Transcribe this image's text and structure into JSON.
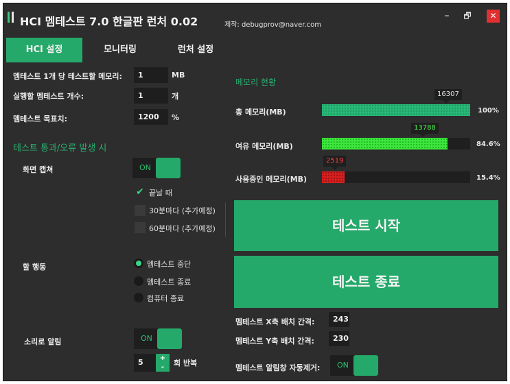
{
  "window": {
    "title": "HCI 멤테스트 7.0 한글판 런처 0.02",
    "maker": "제작: debugprov@naver.com",
    "minimize_glyph": "–",
    "restore_glyph": "🗗",
    "close_glyph": "✕"
  },
  "tabs": [
    {
      "label": "HCI 설정",
      "active": true
    },
    {
      "label": "모니터링",
      "active": false
    },
    {
      "label": "런처 설정",
      "active": false
    }
  ],
  "settings": {
    "memory_per_test": {
      "label": "멤테스트 1개 당 테스트할 메모리:",
      "value": "1",
      "unit": "MB"
    },
    "instance_count": {
      "label": "실행할 멤테스트 개수:",
      "value": "1",
      "unit": "개"
    },
    "target": {
      "label": "멤테스트 목표치:",
      "value": "1200",
      "unit": "%"
    }
  },
  "on_event": {
    "section_title": "테스트 통과/오류 발생 시",
    "capture": {
      "label": "화면 캡쳐",
      "toggle": "ON"
    },
    "capture_options": [
      {
        "label": "끝날 때",
        "checked": true,
        "glyph": "✔"
      },
      {
        "label": "30분마다 (추가예정)",
        "checked": false
      },
      {
        "label": "60분마다 (추가예정)",
        "checked": false
      }
    ],
    "action": {
      "label": "할 행동",
      "options": [
        {
          "label": "멤테스트 중단",
          "selected": true
        },
        {
          "label": "멤테스트 종료",
          "selected": false
        },
        {
          "label": "컴퓨터 종료",
          "selected": false
        }
      ]
    },
    "sound": {
      "label": "소리로 알림",
      "toggle": "ON",
      "repeat": "5",
      "plus": "+",
      "minus": "-",
      "repeat_unit": "회 반복"
    }
  },
  "memory": {
    "section_title": "메모리 현황",
    "total": {
      "label": "총 메모리(MB)",
      "value": "16307",
      "percent_text": "100%",
      "fraction": 1.0,
      "color": "#28b878"
    },
    "free": {
      "label": "여유 메모리(MB)",
      "value": "13788",
      "percent_text": "84.6%",
      "fraction": 0.846,
      "color": "#3ee63e"
    },
    "used": {
      "label": "사용중인 메모리(MB)",
      "value": "2519",
      "percent_text": "15.4%",
      "fraction": 0.154,
      "color": "#d42020"
    }
  },
  "buttons": {
    "start": "테스트 시작",
    "stop": "테스트 종료"
  },
  "layout_opts": {
    "x_gap": {
      "label": "멤테스트 X축 배치 간격:",
      "value": "243"
    },
    "y_gap": {
      "label": "멤테스트 Y축 배치 간격:",
      "value": "230"
    },
    "auto_close": {
      "label": "멤테스트 알림창 자동제거:",
      "toggle": "ON"
    }
  },
  "colors": {
    "accent": "#25a96a",
    "background": "#2d2d2d",
    "close": "#e03030",
    "section_title": "#29b070"
  }
}
